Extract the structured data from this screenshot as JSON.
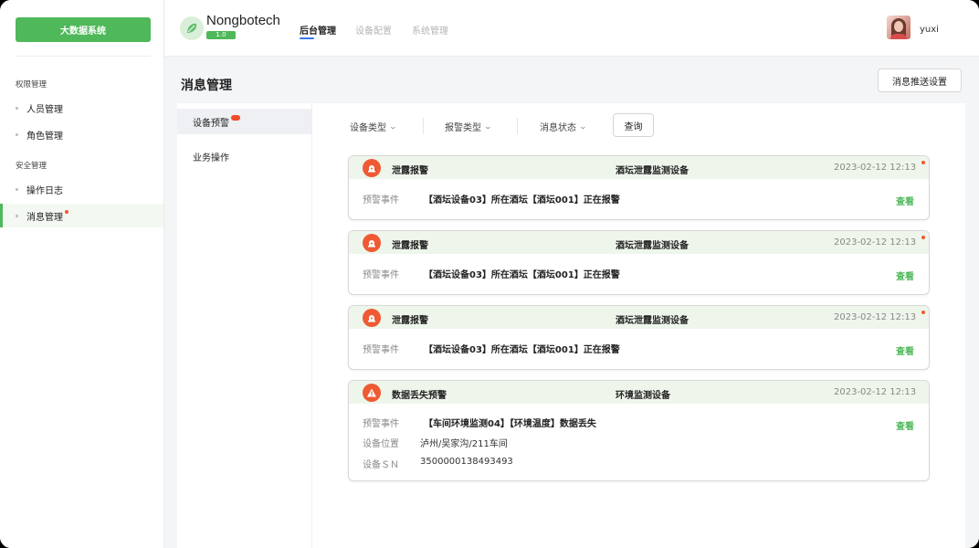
{
  "sidebar": {
    "brand_button": "大数据系统",
    "group_permissions": "权限管理",
    "group_security": "安全管理",
    "items": [
      {
        "label": "人员管理"
      },
      {
        "label": "角色管理"
      },
      {
        "label": "操作日志"
      },
      {
        "label": "消息管理"
      }
    ]
  },
  "header": {
    "logo_text": "Nongbotech",
    "version": "1.0",
    "nav": [
      {
        "label": "后台管理"
      },
      {
        "label": "设备配置"
      },
      {
        "label": "系统管理"
      }
    ],
    "username": "yuxi"
  },
  "page": {
    "title": "消息管理",
    "push_settings_button": "消息推送设置"
  },
  "subnav": {
    "items": [
      {
        "label": "设备预警"
      },
      {
        "label": "业务操作"
      }
    ]
  },
  "filters": {
    "device_type": "设备类型",
    "alarm_type": "报警类型",
    "message_status": "消息状态",
    "query_button": "查询"
  },
  "messages": [
    {
      "type": "泄露报警",
      "device": "酒坛泄露监测设备",
      "time": "2023-02-12 12:13",
      "event_label": "预警事件",
      "event": "【酒坛设备03】所在酒坛【酒坛001】正在报警",
      "view": "查看"
    },
    {
      "type": "泄露报警",
      "device": "酒坛泄露监测设备",
      "time": "2023-02-12 12:13",
      "event_label": "预警事件",
      "event": "【酒坛设备03】所在酒坛【酒坛001】正在报警",
      "view": "查看"
    },
    {
      "type": "泄露报警",
      "device": "酒坛泄露监测设备",
      "time": "2023-02-12 12:13",
      "event_label": "预警事件",
      "event": "【酒坛设备03】所在酒坛【酒坛001】正在报警",
      "view": "查看"
    },
    {
      "type": "数据丢失预警",
      "device": "环境监测设备",
      "time": "2023-02-12 12:13",
      "event_label": "预警事件",
      "event": "【车间环境监测04】【环境温度】数据丢失",
      "location_label": "设备位置",
      "location": "泸州/吴家沟/211车间",
      "sn_label": "设备ＳＮ",
      "sn": "3500000138493493",
      "view": "查看"
    }
  ],
  "colors": {
    "accent_green": "#4fb85a",
    "alert_orange": "#ef5a33",
    "unread_dot": "#f25a2b",
    "nav_underline": "#3478f6"
  }
}
